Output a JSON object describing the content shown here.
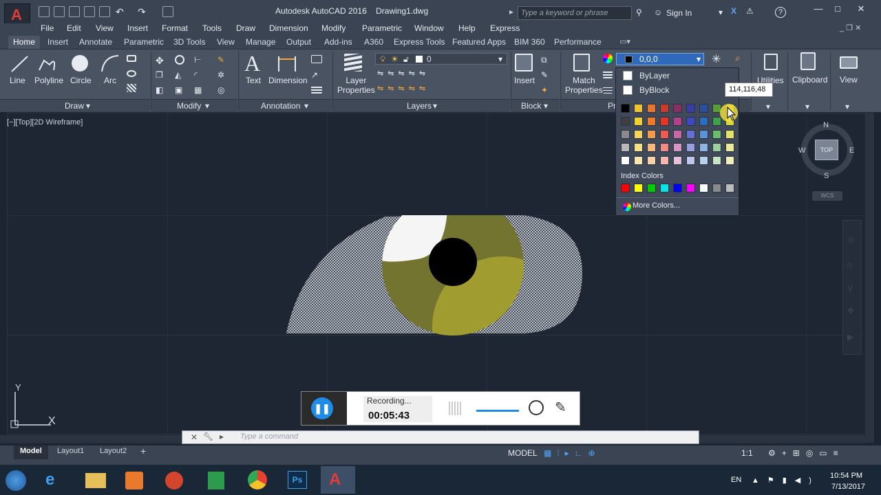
{
  "titlebar": {
    "app_title": "Autodesk AutoCAD 2016",
    "document": "Drawing1.dwg",
    "search_placeholder": "Type a keyword or phrase",
    "sign_in": "Sign In"
  },
  "menubar": [
    "File",
    "Edit",
    "View",
    "Insert",
    "Format",
    "Tools",
    "Draw",
    "Dimension",
    "Modify",
    "Parametric",
    "Window",
    "Help",
    "Express"
  ],
  "ribbon_tabs": [
    "Home",
    "Insert",
    "Annotate",
    "Parametric",
    "3D Tools",
    "View",
    "Manage",
    "Output",
    "Add-ins",
    "A360",
    "Express Tools",
    "Featured Apps",
    "BIM 360",
    "Performance"
  ],
  "ribbon": {
    "draw": {
      "line": "Line",
      "polyline": "Polyline",
      "circle": "Circle",
      "arc": "Arc",
      "panel": "Draw"
    },
    "modify": {
      "panel": "Modify"
    },
    "annotation": {
      "text": "Text",
      "dimension": "Dimension",
      "panel": "Annotation"
    },
    "layers": {
      "layer_properties": "Layer\nProperties",
      "layer_value": "0",
      "panel": "Layers"
    },
    "block": {
      "insert": "Insert",
      "panel": "Block"
    },
    "properties": {
      "match": "Match\nProperties",
      "panel": "Pr",
      "color_value": "0,0,0"
    },
    "utilities": "Utilities",
    "clipboard": "Clipboard",
    "view": "View"
  },
  "color_popup": {
    "bylayer": "ByLayer",
    "byblock": "ByBlock",
    "index_colors_label": "Index Colors",
    "more_colors": "More Colors...",
    "tooltip": "114,116,48"
  },
  "viewport": {
    "label": "[−][Top][2D Wireframe]",
    "viewcube": {
      "n": "N",
      "s": "S",
      "e": "E",
      "w": "W",
      "top": "TOP",
      "wcs": "WCS"
    },
    "ucs_y": "Y",
    "ucs_x": "X"
  },
  "recorder": {
    "status": "Recording...",
    "time": "00:05:43"
  },
  "command_line": {
    "placeholder": "Type a command"
  },
  "layout_tabs": [
    "Model",
    "Layout1",
    "Layout2"
  ],
  "status": {
    "model": "MODEL",
    "scale": "1:1"
  },
  "taskbar": {
    "lang": "EN",
    "time": "10:54 PM",
    "date": "7/13/2017"
  },
  "colors": {
    "eye_iris": "#727430",
    "eye_iris_light": "#a09c30",
    "accent_blue": "#1e8ce8"
  }
}
